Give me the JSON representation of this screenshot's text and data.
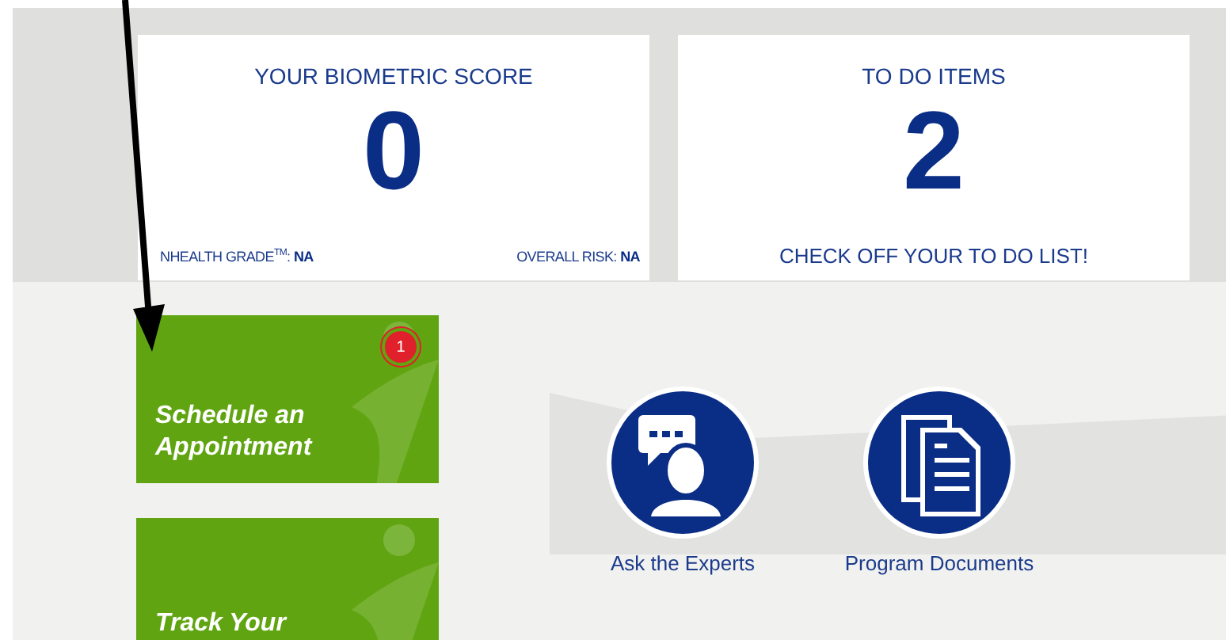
{
  "summary_cards": [
    {
      "kind": "score",
      "title": "YOUR BIOMETRIC SCORE",
      "value": "0",
      "footer_left": "NHEALTH GRADE$^{TM}$: **NA**",
      "footer_right": "OVERALL RISK: **NA**"
    },
    {
      "kind": "todo",
      "title": "TO DO ITEMS",
      "value": "2",
      "footer": "CHECK OFF YOUR TO DO LIST!"
    }
  ],
  "tiles": [
    {
      "label": "Schedule an Appointment",
      "badge": "1"
    },
    {
      "label": "Track Your"
    }
  ],
  "quick_links": [
    {
      "kind": "experts",
      "label": "Ask the Experts"
    },
    {
      "kind": "documents",
      "label": "Program Documents"
    }
  ]
}
